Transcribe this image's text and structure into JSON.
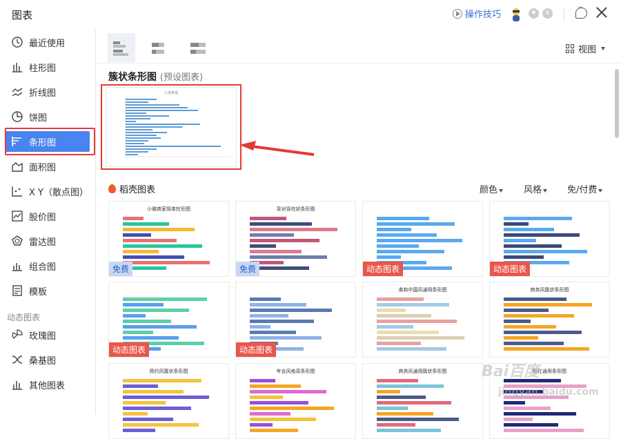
{
  "app": {
    "title": "图表"
  },
  "toolbar": {
    "help_label": "操作技巧"
  },
  "sidebar": {
    "items": [
      {
        "label": "最近使用",
        "icon": "clock-icon"
      },
      {
        "label": "柱形图",
        "icon": "column-chart-icon"
      },
      {
        "label": "折线图",
        "icon": "line-chart-icon"
      },
      {
        "label": "饼图",
        "icon": "pie-chart-icon"
      },
      {
        "label": "条形图",
        "icon": "bar-chart-icon",
        "active": true
      },
      {
        "label": "面积图",
        "icon": "area-chart-icon"
      },
      {
        "label": "X Y（散点图）",
        "icon": "scatter-chart-icon"
      },
      {
        "label": "股价图",
        "icon": "stock-chart-icon"
      },
      {
        "label": "雷达图",
        "icon": "radar-chart-icon"
      },
      {
        "label": "组合图",
        "icon": "combo-chart-icon"
      },
      {
        "label": "模板",
        "icon": "template-icon"
      }
    ],
    "section_label": "动态图表",
    "dynamic_items": [
      {
        "label": "玫瑰图",
        "icon": "rose-chart-icon"
      },
      {
        "label": "桑基图",
        "icon": "sankey-chart-icon"
      },
      {
        "label": "其他图表",
        "icon": "other-chart-icon"
      }
    ]
  },
  "main": {
    "view_label": "视图",
    "section_title": "簇状条形图",
    "section_subtitle": "(预设图表)",
    "preset_chart_title": "入选率值",
    "docer_title": "稻壳图表",
    "filters": [
      "颜色",
      "风格",
      "免/付费"
    ],
    "cards": [
      {
        "title": "小微商家简单柱形图",
        "tag": "免费",
        "tag_type": "free"
      },
      {
        "title": "背对背柱状条形图",
        "tag": "免费",
        "tag_type": "free"
      },
      {
        "title": "",
        "tag": "动态图表",
        "tag_type": "dyn"
      },
      {
        "title": "",
        "tag": "动态图表",
        "tag_type": "dyn"
      },
      {
        "title": "",
        "tag": "动态图表",
        "tag_type": "dyn"
      },
      {
        "title": "",
        "tag": "动态图表",
        "tag_type": "dyn"
      },
      {
        "title": "柔和中国风通用条形图",
        "tag": "",
        "tag_type": ""
      },
      {
        "title": "商务风簇状条形图",
        "tag": "",
        "tag_type": ""
      },
      {
        "title": "简约风簇状条形图",
        "tag": "",
        "tag_type": ""
      },
      {
        "title": "年会风格双条形图",
        "tag": "",
        "tag_type": ""
      },
      {
        "title": "商务风通用簇状条形图",
        "tag": "",
        "tag_type": ""
      },
      {
        "title": "粉红通用条形图",
        "tag": "",
        "tag_type": ""
      }
    ]
  },
  "watermark": {
    "text": "Bai百度",
    "subtext": "jingyan.baidu.com"
  },
  "colors": {
    "accent": "#4a84ef",
    "highlight": "#e53935",
    "bar_blue": "#5b9bd5"
  }
}
